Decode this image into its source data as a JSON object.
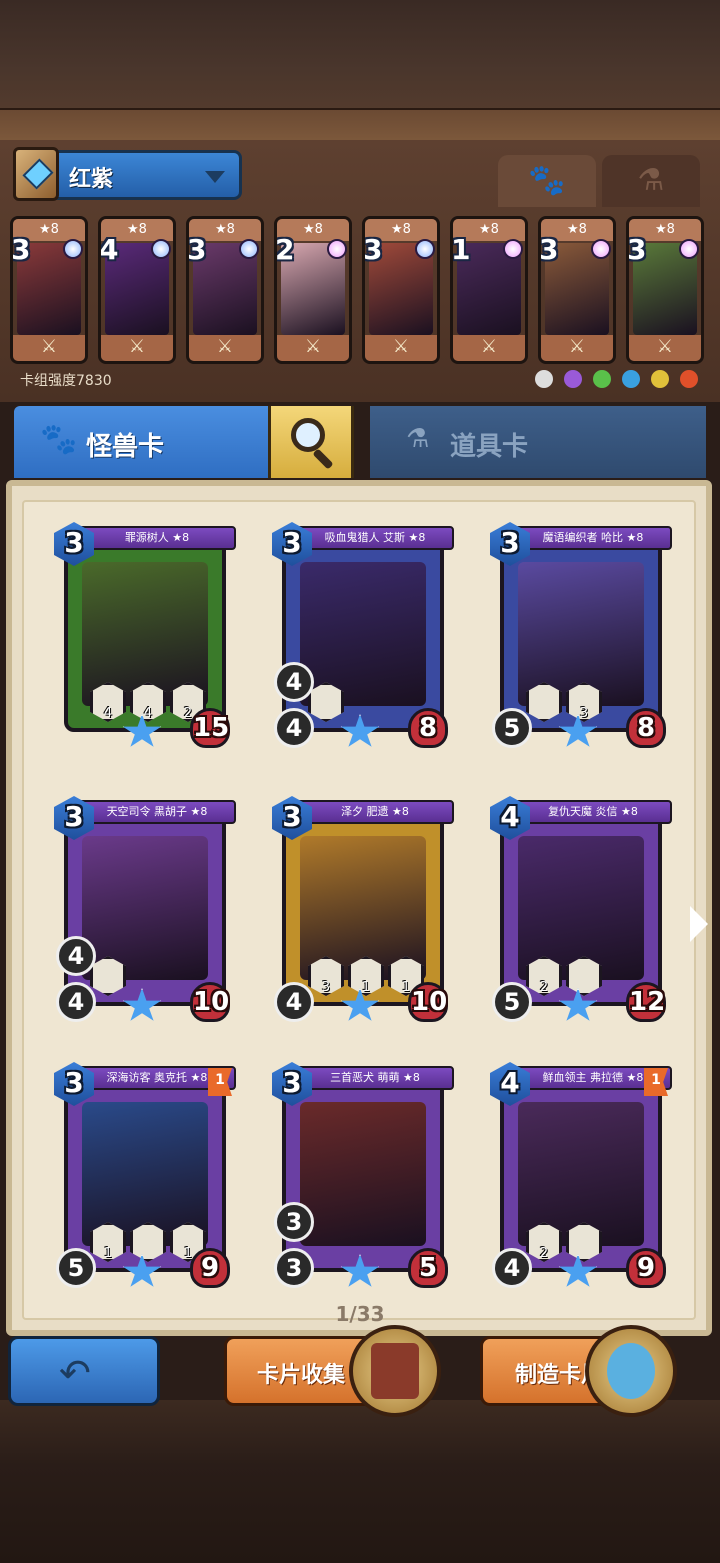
{
  "deck": {
    "name": "红紫",
    "strength_label": "卡组强度7830",
    "cards": [
      {
        "cost": "3",
        "stars": "★8",
        "art": "#8a3a3a",
        "gem": "#8fb6ff"
      },
      {
        "cost": "4",
        "stars": "★8",
        "art": "#5a2a7a",
        "gem": "#8fb6ff"
      },
      {
        "cost": "3",
        "stars": "★8",
        "art": "#6a3a6a",
        "gem": "#8fb6ff"
      },
      {
        "cost": "2",
        "stars": "★8",
        "art": "#d8a8b0",
        "gem": "#f0a0ff"
      },
      {
        "cost": "3",
        "stars": "★8",
        "art": "#a04a3a",
        "gem": "#8fb6ff"
      },
      {
        "cost": "1",
        "stars": "★8",
        "art": "#4a2a5a",
        "gem": "#f0a0ff"
      },
      {
        "cost": "3",
        "stars": "★8",
        "art": "#8a5a3a",
        "gem": "#f0a0ff"
      },
      {
        "cost": "3",
        "stars": "★8",
        "art": "#5a7a3a",
        "gem": "#f0a0ff"
      }
    ],
    "element_icons": [
      "circle-icon",
      "purple-icon",
      "green-icon",
      "blue-icon",
      "yellow-icon",
      "fire-icon"
    ]
  },
  "header_tabs": {
    "paw": "🐾",
    "potion": "⚗"
  },
  "tabs": {
    "monster": "怪兽卡",
    "item": "道具卡"
  },
  "cards": [
    {
      "name": "罪源树人 ★8",
      "cost": "3",
      "left": "",
      "atk": "",
      "hp": "15",
      "art": "#4a6a2a",
      "frame": "#3a7a2a",
      "abilities": [
        "4",
        "4",
        "2"
      ],
      "flag": ""
    },
    {
      "name": "吸血鬼猎人 艾斯 ★8",
      "cost": "3",
      "left": "4",
      "atk": "4",
      "hp": "8",
      "art": "#3a2a6a",
      "frame": "#3a4aa0",
      "abilities": [
        ""
      ],
      "flag": ""
    },
    {
      "name": "魔语编织者 哈比 ★8",
      "cost": "3",
      "left": "",
      "atk": "5",
      "hp": "8",
      "art": "#5a4aa0",
      "frame": "#3a4aa0",
      "abilities": [
        "",
        "3"
      ],
      "flag": ""
    },
    {
      "name": "天空司令 黑胡子 ★8",
      "cost": "3",
      "left": "4",
      "atk": "4",
      "hp": "10",
      "art": "#6a3a8a",
      "frame": "#6a3fa3",
      "abilities": [
        ""
      ],
      "flag": ""
    },
    {
      "name": "泽夕 肥遗 ★8",
      "cost": "3",
      "left": "",
      "atk": "4",
      "hp": "10",
      "art": "#b07a2a",
      "frame": "#c0902a",
      "abilities": [
        "3",
        "1",
        "1"
      ],
      "flag": ""
    },
    {
      "name": "复仇天魔 炎信 ★8",
      "cost": "4",
      "left": "",
      "atk": "5",
      "hp": "12",
      "art": "#4a2a6a",
      "frame": "#6a3fa3",
      "abilities": [
        "2",
        ""
      ],
      "flag": ""
    },
    {
      "name": "深海访客 奥克托 ★8",
      "cost": "3",
      "left": "",
      "atk": "5",
      "hp": "9",
      "art": "#2a4a8a",
      "frame": "#6a3fa3",
      "abilities": [
        "1",
        "",
        "1"
      ],
      "flag": "1"
    },
    {
      "name": "三首恶犬 萌萌 ★8",
      "cost": "3",
      "left": "3",
      "atk": "3",
      "hp": "5",
      "art": "#6a2a2a",
      "frame": "#6a3fa3",
      "abilities": [],
      "flag": ""
    },
    {
      "name": "鲜血领主 弗拉德 ★8",
      "cost": "4",
      "left": "",
      "atk": "4",
      "hp": "9",
      "art": "#4a2a5a",
      "frame": "#6a3fa3",
      "abilities": [
        "2",
        ""
      ],
      "flag": "1"
    }
  ],
  "pagination": "1/33",
  "buttons": {
    "back": "↶",
    "collection": "卡片收集",
    "craft": "制造卡片"
  }
}
